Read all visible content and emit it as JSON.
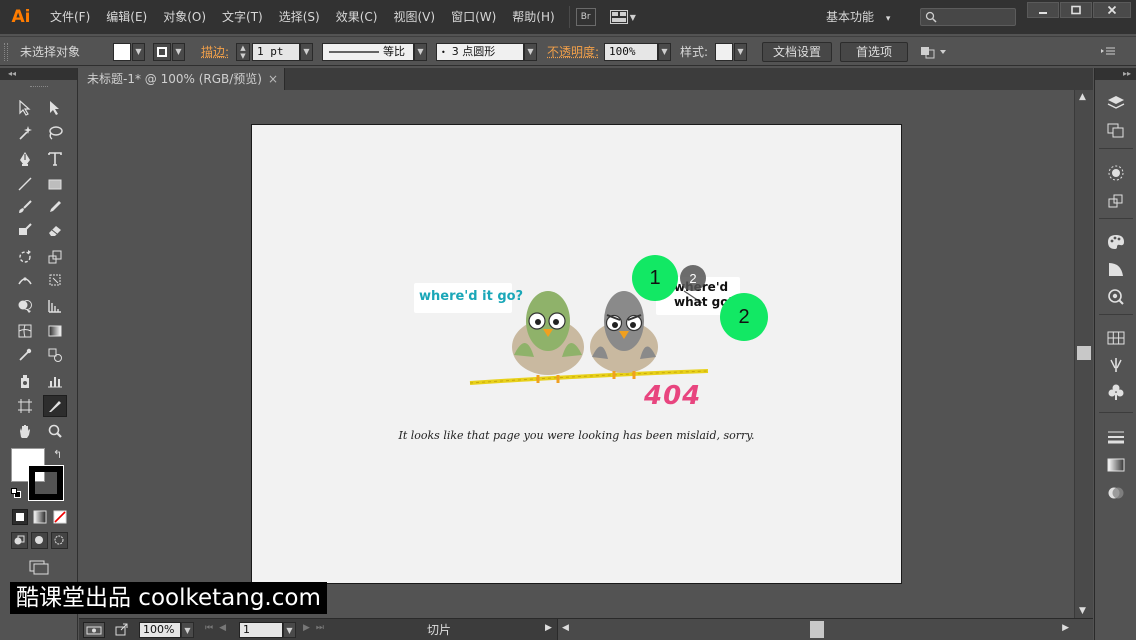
{
  "app": {
    "logo": "Ai"
  },
  "menu": [
    "文件(F)",
    "编辑(E)",
    "对象(O)",
    "文字(T)",
    "选择(S)",
    "效果(C)",
    "视图(V)",
    "窗口(W)",
    "帮助(H)"
  ],
  "menubar": {
    "bridge_label": "Br",
    "workspace": "基本功能",
    "workspace_arrow": "▾"
  },
  "control": {
    "no_selection": "未选择对象",
    "stroke_label": "描边:",
    "stroke_weight": "1 pt",
    "profile_label": "等比",
    "brush_label": "3 点圆形",
    "opacity_label": "不透明度:",
    "opacity_value": "100%",
    "style_label": "样式:",
    "doc_setup": "文档设置",
    "preferences": "首选项"
  },
  "document": {
    "tab_title": "未标题-1* @ 100% (RGB/预览)",
    "close": "×"
  },
  "status": {
    "zoom": "100%",
    "artboard": "1",
    "tool_name": "切片"
  },
  "artwork": {
    "bubble_left": "where'd it go?",
    "bubble_right_line1": "where'd",
    "bubble_right_line2": "what go?",
    "code": "404",
    "message": "It looks like that page you were looking has been mislaid, sorry."
  },
  "markers": [
    "1",
    "2",
    "2"
  ],
  "watermark": "酷课堂出品 coolketang.com",
  "colors": {
    "accent_orange": "#ff7c00",
    "marker_green": "#12e864",
    "marker_gray": "#555555",
    "bubble_blue": "#1aa7b8",
    "code_pink": "#e8457f",
    "rope_yellow": "#e8d11a"
  }
}
